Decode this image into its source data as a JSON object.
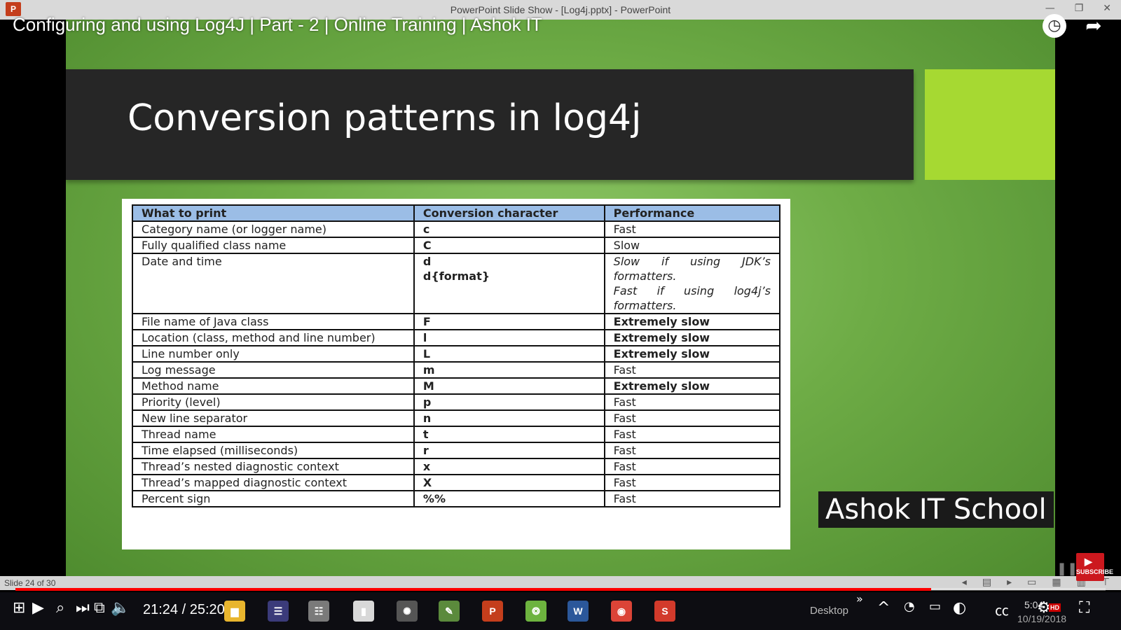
{
  "window": {
    "app_badge": "P",
    "title": "PowerPoint Slide Show - [Log4j.pptx] - PowerPoint",
    "buttons": [
      "—",
      "❐",
      "✕"
    ]
  },
  "video": {
    "title": "Configuring and using Log4J | Part - 2 | Online Training | Ashok IT",
    "time_current": "21:24",
    "time_total": "25:20",
    "progress_fraction": 0.84
  },
  "slide": {
    "title": "Conversion patterns in log4j",
    "accent_color": "#a6d932",
    "watermark": "Ashok IT School",
    "status": "Slide 24 of 30",
    "table": {
      "headers": [
        "What to print",
        "Conversion character",
        "Performance"
      ],
      "rows": [
        {
          "what": "Category name (or logger name)",
          "char": "c",
          "perf": "Fast",
          "perf_style": "normal"
        },
        {
          "what": "Fully qualified class name",
          "char": "C",
          "perf": "Slow",
          "perf_style": "normal"
        },
        {
          "what": "Date and time",
          "char": "d",
          "char2": "d{format}",
          "perf": "Slow if using JDK’s formatters.",
          "perf2": "Fast if using log4j’s formatters.",
          "perf_style": "italic"
        },
        {
          "what": "File name of Java class",
          "char": "F",
          "perf": "Extremely slow",
          "perf_style": "bold"
        },
        {
          "what": "Location (class, method and line number)",
          "char": "l",
          "perf": "Extremely slow",
          "perf_style": "bold"
        },
        {
          "what": "Line number only",
          "char": "L",
          "perf": "Extremely slow",
          "perf_style": "bold"
        },
        {
          "what": "Log message",
          "char": "m",
          "perf": "Fast",
          "perf_style": "normal"
        },
        {
          "what": "Method name",
          "char": "M",
          "perf": "Extremely slow",
          "perf_style": "bold"
        },
        {
          "what": "Priority (level)",
          "char": "p",
          "perf": "Fast",
          "perf_style": "normal"
        },
        {
          "what": "New line separator",
          "char": "n",
          "perf": "Fast",
          "perf_style": "normal"
        },
        {
          "what": "Thread name",
          "char": "t",
          "perf": "Fast",
          "perf_style": "normal"
        },
        {
          "what": "Time elapsed (milliseconds)",
          "char": "r",
          "perf": "Fast",
          "perf_style": "normal"
        },
        {
          "what": "Thread’s nested diagnostic context",
          "char": "x",
          "perf": "Fast",
          "perf_style": "normal"
        },
        {
          "what": "Thread’s mapped diagnostic context",
          "char": "X",
          "perf": "Fast",
          "perf_style": "normal"
        },
        {
          "what": "Percent sign",
          "char": "%%",
          "perf": "Fast",
          "perf_style": "normal"
        }
      ]
    }
  },
  "youtube": {
    "subscribe_label": "SUBSCRIBE",
    "hd_label": "HD",
    "icons": [
      "watch-later-icon",
      "share-icon",
      "play-icon",
      "next-icon",
      "miniplayer-icon",
      "volume-icon",
      "autoplay-toggle-icon",
      "captions-icon",
      "settings-icon",
      "fullscreen-icon"
    ]
  },
  "taskbar": {
    "desktop_label": "Desktop",
    "clock_time": "5:04",
    "clock_date": "10/19/2018",
    "apps": [
      {
        "name": "file-explorer",
        "glyph": "▆",
        "color": "#e8b52e"
      },
      {
        "name": "eclipse",
        "glyph": "☰",
        "color": "#3b3b7a"
      },
      {
        "name": "database",
        "glyph": "☷",
        "color": "#7a7a7a"
      },
      {
        "name": "notepad",
        "glyph": "▮",
        "color": "#d8d8d8"
      },
      {
        "name": "settings-gear",
        "glyph": "✺",
        "color": "#555555"
      },
      {
        "name": "editor",
        "glyph": "✎",
        "color": "#5b8a3c"
      },
      {
        "name": "powerpoint",
        "glyph": "P",
        "color": "#c43e1c"
      },
      {
        "name": "spring-tool",
        "glyph": "❂",
        "color": "#6db33f"
      },
      {
        "name": "word",
        "glyph": "W",
        "color": "#2b579a"
      },
      {
        "name": "chrome",
        "glyph": "◉",
        "color": "#db4437"
      },
      {
        "name": "snagit",
        "glyph": "S",
        "color": "#d23a2b"
      }
    ]
  }
}
